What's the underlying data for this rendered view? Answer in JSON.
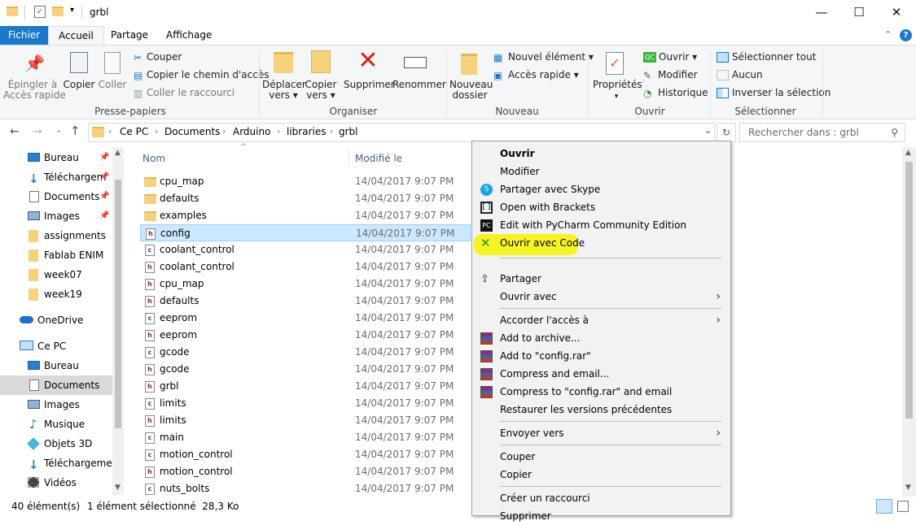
{
  "window": {
    "title": "grbl",
    "minimize": "—",
    "maximize": "☐",
    "close": "✕"
  },
  "ribbon_tabs": [
    "Fichier",
    "Accueil",
    "Partage",
    "Affichage"
  ],
  "ribbon": {
    "clipboard": {
      "pin": "Épingler à\nAccès rapide",
      "copy": "Copier",
      "paste": "Coller",
      "cut": "Couper",
      "copy_path": "Copier le chemin d'accès",
      "paste_shortcut": "Coller le raccourci",
      "label": "Presse-papiers"
    },
    "organize": {
      "move": "Déplacer\nvers ▾",
      "copy_to": "Copier\nvers ▾",
      "delete": "Supprimer",
      "rename": "Renommer",
      "label": "Organiser"
    },
    "new": {
      "new_folder": "Nouveau\ndossier",
      "new_item": "Nouvel élément ▾",
      "easy_access": "Accès rapide ▾",
      "label": "Nouveau"
    },
    "open": {
      "properties": "Propriétés",
      "open": "Ouvrir ▾",
      "edit": "Modifier",
      "history": "Historique",
      "label": "Ouvrir"
    },
    "select": {
      "select_all": "Sélectionner tout",
      "select_none": "Aucun",
      "invert": "Inverser la sélection",
      "label": "Sélectionner"
    }
  },
  "address": {
    "path": [
      "Ce PC",
      "Documents",
      "Arduino",
      "libraries",
      "grbl"
    ],
    "search_placeholder": "Rechercher dans : grbl"
  },
  "nav": {
    "quick": [
      "Bureau",
      "Téléchargem",
      "Documents",
      "Images",
      "assignments",
      "Fablab ENIM",
      "week07",
      "week19"
    ],
    "onedrive": "OneDrive",
    "thispc": "Ce PC",
    "pc_items": [
      "Bureau",
      "Documents",
      "Images",
      "Musique",
      "Objets 3D",
      "Téléchargement",
      "Vidéos"
    ]
  },
  "columns": {
    "name": "Nom",
    "modified": "Modifié le"
  },
  "files": [
    {
      "name": "cpu_map",
      "type": "folder",
      "date": "14/04/2017 9:07 PM"
    },
    {
      "name": "defaults",
      "type": "folder",
      "date": "14/04/2017 9:07 PM"
    },
    {
      "name": "examples",
      "type": "folder",
      "date": "14/04/2017 9:07 PM"
    },
    {
      "name": "config",
      "type": "h",
      "date": "14/04/2017 9:07 PM"
    },
    {
      "name": "coolant_control",
      "type": "c",
      "date": "14/04/2017 9:07 PM"
    },
    {
      "name": "coolant_control",
      "type": "h",
      "date": "14/04/2017 9:07 PM"
    },
    {
      "name": "cpu_map",
      "type": "h",
      "date": "14/04/2017 9:07 PM"
    },
    {
      "name": "defaults",
      "type": "h",
      "date": "14/04/2017 9:07 PM"
    },
    {
      "name": "eeprom",
      "type": "c",
      "date": "14/04/2017 9:07 PM"
    },
    {
      "name": "eeprom",
      "type": "h",
      "date": "14/04/2017 9:07 PM"
    },
    {
      "name": "gcode",
      "type": "c",
      "date": "14/04/2017 9:07 PM"
    },
    {
      "name": "gcode",
      "type": "h",
      "date": "14/04/2017 9:07 PM"
    },
    {
      "name": "grbl",
      "type": "h",
      "date": "14/04/2017 9:07 PM"
    },
    {
      "name": "limits",
      "type": "c",
      "date": "14/04/2017 9:07 PM"
    },
    {
      "name": "limits",
      "type": "h",
      "date": "14/04/2017 9:07 PM"
    },
    {
      "name": "main",
      "type": "c",
      "date": "14/04/2017 9:07 PM"
    },
    {
      "name": "motion_control",
      "type": "c",
      "date": "14/04/2017 9:07 PM"
    },
    {
      "name": "motion_control",
      "type": "h",
      "date": "14/04/2017 9:07 PM"
    },
    {
      "name": "nuts_bolts",
      "type": "c",
      "date": "14/04/2017 9:07 PM"
    }
  ],
  "status": {
    "count": "40 élément(s)",
    "selection": "1 élément sélectionné  28,3 Ko"
  },
  "context_menu": [
    {
      "label": "Ouvrir",
      "bold": true
    },
    {
      "label": "Modifier"
    },
    {
      "label": "Partager avec Skype",
      "icon": "skype-icon"
    },
    {
      "label": "Open with Brackets",
      "icon": "brackets-icon"
    },
    {
      "label": "Edit with PyCharm Community Edition",
      "icon": "pycharm-icon"
    },
    {
      "label": "Ouvrir avec Code",
      "icon": "vscode-icon",
      "highlight": true
    },
    {
      "label": "Partager",
      "icon": "share-icon"
    },
    {
      "label": "Ouvrir avec",
      "submenu": true
    },
    {
      "label": "Accorder l'accès à",
      "submenu": true
    },
    {
      "label": "Add to archive...",
      "icon": "winrar-icon"
    },
    {
      "label": "Add to \"config.rar\"",
      "icon": "winrar-icon"
    },
    {
      "label": "Compress and email...",
      "icon": "winrar-icon"
    },
    {
      "label": "Compress to \"config.rar\" and email",
      "icon": "winrar-icon"
    },
    {
      "label": "Restaurer les versions précédentes"
    },
    {
      "label": "Envoyer vers",
      "submenu": true
    },
    {
      "label": "Couper"
    },
    {
      "label": "Copier"
    },
    {
      "label": "Créer un raccourci"
    },
    {
      "label": "Supprimer"
    }
  ],
  "colors": {
    "accent": "#1979ca",
    "selection": "#cce8ff",
    "highlight": "#f4f40a"
  }
}
